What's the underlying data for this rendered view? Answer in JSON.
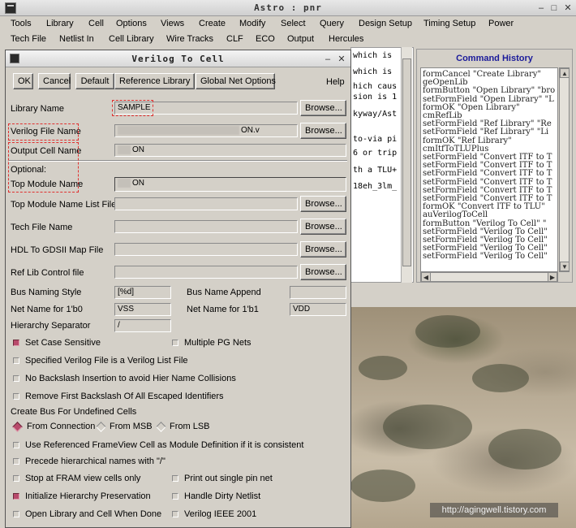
{
  "window": {
    "title": "Astro : pnr",
    "controls": {
      "minimize": "–",
      "maximize": "□",
      "close": "✕"
    }
  },
  "menubar": {
    "row1": [
      "Tools",
      "Library",
      "Cell",
      "Options",
      "Views",
      "Create",
      "Modify",
      "Select",
      "Query",
      "Design Setup",
      "Timing Setup",
      "Power"
    ],
    "row2": [
      "Tech File",
      "Netlist In",
      "Cell Library",
      "Wire Tracks",
      "CLF",
      "ECO",
      "Output",
      "Hercules"
    ]
  },
  "log_panel": {
    "lines": [
      "which is",
      "which is",
      "hich caus",
      "sion is 1",
      "",
      "kyway/Ast",
      "",
      "to-via pi",
      "6 or trip",
      "th a TLU+",
      "18eh_3lm_"
    ]
  },
  "command_history": {
    "heading": "Command History",
    "commands": [
      "formCancel \"Create Library\"",
      "geOpenLib",
      "formButton \"Open Library\" \"bro",
      "setFormField \"Open Library\" \"L",
      "formOK \"Open Library\"",
      "cmRefLib",
      "setFormField \"Ref Library\" \"Re",
      "setFormField \"Ref Library\" \"Li",
      "formOK \"Ref Library\"",
      "cmItfToTLUPlus",
      "setFormField \"Convert ITF to T",
      "setFormField \"Convert ITF to T",
      "setFormField \"Convert ITF to T",
      "setFormField \"Convert ITF to T",
      "setFormField \"Convert ITF to T",
      "setFormField \"Convert ITF to T",
      "formOK \"Convert ITF to TLU\"",
      "auVerilogToCell",
      "formButton \"Verilog To Cell\" \"",
      "setFormField \"Verilog To Cell\"",
      "setFormField \"Verilog To Cell\"",
      "setFormField \"Verilog To Cell\"",
      "setFormField \"Verilog To Cell\""
    ]
  },
  "watermark": "http://agingwell.tistory.com",
  "dialog": {
    "title": "Verilog To Cell",
    "controls": {
      "minimize": "–",
      "close": "✕"
    },
    "buttons": {
      "ok": "OK",
      "cancel": "Cancel",
      "default": "Default",
      "reference_library": "Reference Library",
      "global_net_options": "Global Net Options",
      "help": "Help",
      "browse": "Browse..."
    },
    "fields": {
      "library_name": {
        "label": "Library Name",
        "value": "SAMPLE"
      },
      "verilog_file_name": {
        "label": "Verilog File Name",
        "value": "ON.v"
      },
      "output_cell_name": {
        "label": "Output Cell Name",
        "value": "ON"
      },
      "optional_label": "Optional:",
      "top_module_name": {
        "label": "Top Module Name",
        "value": "ON"
      },
      "top_module_name_list_file": {
        "label": "Top Module Name List File",
        "value": ""
      },
      "tech_file_name": {
        "label": "Tech File Name",
        "value": ""
      },
      "hdl_to_gdsii_map_file": {
        "label": "HDL To GDSII Map File",
        "value": ""
      },
      "ref_lib_control_file": {
        "label": "Ref Lib Control file",
        "value": ""
      },
      "bus_naming_style": {
        "label": "Bus Naming Style",
        "value": "[%d]"
      },
      "bus_name_append": {
        "label": "Bus Name Append",
        "value": ""
      },
      "net_name_1b0": {
        "label": "Net Name for 1'b0",
        "value": "VSS"
      },
      "net_name_1b1": {
        "label": "Net Name for 1'b1",
        "value": "VDD"
      },
      "hierarchy_separator": {
        "label": "Hierarchy Separator",
        "value": "/"
      }
    },
    "options": {
      "set_case_sensitive": {
        "label": "Set Case Sensitive",
        "checked": true
      },
      "multiple_pg_nets": {
        "label": "Multiple PG Nets",
        "checked": false
      },
      "verilog_list_file": {
        "label": "Specified Verilog File is a Verilog List File",
        "checked": false
      },
      "no_backslash": {
        "label": "No Backslash Insertion to avoid Hier Name Collisions",
        "checked": false
      },
      "remove_first_backslash": {
        "label": "Remove First Backslash Of All Escaped Identifiers",
        "checked": false
      },
      "create_bus_label": "Create Bus For Undefined Cells",
      "create_bus_options": [
        {
          "label": "From Connection",
          "selected": true
        },
        {
          "label": "From MSB",
          "selected": false
        },
        {
          "label": "From LSB",
          "selected": false
        }
      ],
      "use_frameview": {
        "label": "Use Referenced FrameView Cell as Module Definition if it is consistent",
        "checked": false
      },
      "precede_hierarchical": {
        "label": "Precede hierarchical names with \"/\"",
        "checked": false
      },
      "stop_at_fram": {
        "label": "Stop at FRAM view cells only",
        "checked": false
      },
      "print_single_pin": {
        "label": "Print out single pin net",
        "checked": false
      },
      "initialize_hierarchy": {
        "label": "Initialize Hierarchy Preservation",
        "checked": true
      },
      "handle_dirty_netlist": {
        "label": "Handle Dirty Netlist",
        "checked": false
      },
      "open_library_cell": {
        "label": "Open Library and Cell When Done",
        "checked": false
      },
      "verilog_ieee_2001": {
        "label": "Verilog IEEE 2001",
        "checked": false
      }
    }
  }
}
